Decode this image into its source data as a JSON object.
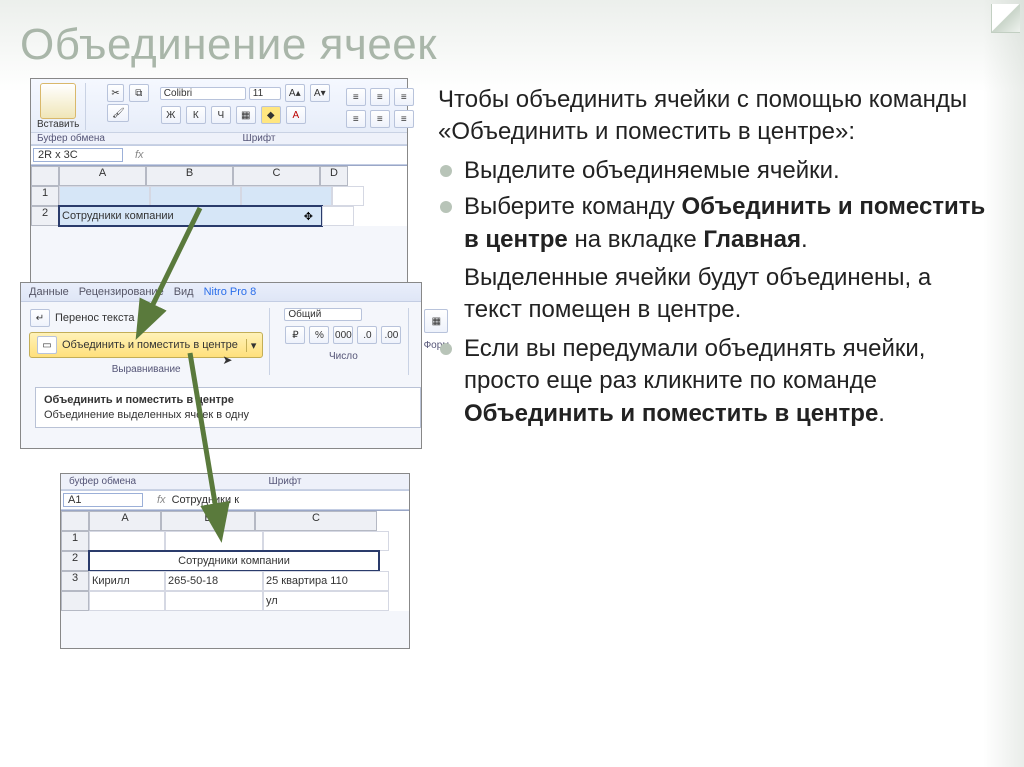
{
  "title": "Объединение ячеек",
  "intro": "Чтобы объединить ячейки с помощью команды «Объединить и поместить в центре»:",
  "bullets": {
    "b1_pre": "Выделите объединяемые ячейки.",
    "b2_pre": "Выберите команду ",
    "b2_bold": "Объединить и поместить в центре",
    "b2_mid": " на вкладке ",
    "b2_bold2": "Главная",
    "b2_end": ".",
    "b3_plain": "Выделенные ячейки будут объединены, а текст помещен в центре.",
    "b4_pre": "Если вы передумали объединять ячейки, просто еще раз кликните по команде ",
    "b4_bold": "Объединить и поместить в центре",
    "b4_end": "."
  },
  "s1": {
    "clipboard_label": "Буфер обмена",
    "font_group_label": "Шрифт",
    "paste_label": "Вставить",
    "font_name": "Colibri",
    "font_size": "11",
    "bold": "Ж",
    "italic": "К",
    "underline": "Ч",
    "namebox": "2R x 3C",
    "fx": "fx",
    "cols": {
      "a": "A",
      "b": "B",
      "c": "C",
      "d": "D"
    },
    "rows": {
      "r1": "1",
      "r2": "2"
    },
    "cell_a2": "Сотрудники компании"
  },
  "s2": {
    "tab1": "Данные",
    "tab2": "Рецензирование",
    "tab3": "Вид",
    "tab4": "Nitro Pro 8",
    "wrap": "Перенос текста",
    "merge": "Объединить и поместить в центре",
    "align_label": "Выравнивание",
    "num_format": "Общий",
    "num_pct": "%",
    "num_000": "000",
    "num_label": "Число",
    "fmt_label": "Форм",
    "tooltip_title": "Объединить и поместить в центре",
    "tooltip_body": "Объединение выделенных ячеек в одну"
  },
  "s3": {
    "clipboard_label": "буфер обмена",
    "font_group_label": "Шрифт",
    "namebox": "A1",
    "fx": "fx",
    "fx_value": "Сотрудники к",
    "cols": {
      "a": "A",
      "b": "B",
      "c": "C"
    },
    "rows": {
      "r1": "1",
      "r2": "2",
      "r3": "3"
    },
    "r2_merged": "Сотрудники компании",
    "r3a": "Кирилл",
    "r3b": "265-50-18",
    "r3c": "25 квартира 110",
    "r3c2": "ул"
  }
}
